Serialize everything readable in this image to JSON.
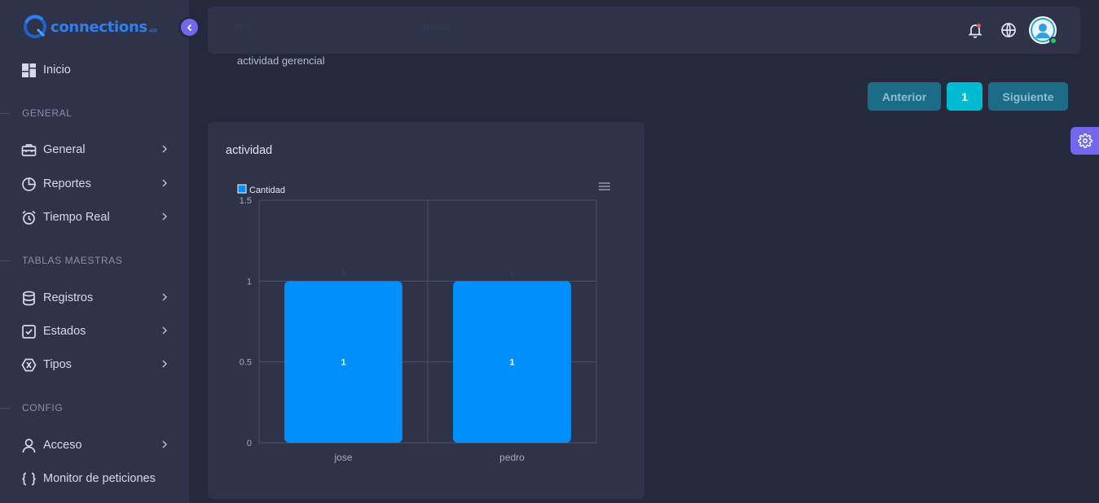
{
  "app": {
    "logo_text": "connections",
    "logo_sub": "app"
  },
  "sidebar": {
    "home": {
      "label": "Inicio",
      "icon": "dashboard-icon"
    },
    "sections": [
      {
        "title": "GENERAL"
      },
      {
        "title": "TABLAS MAESTRAS"
      },
      {
        "title": "CONFIG"
      }
    ],
    "items": [
      {
        "label": "General",
        "icon": "briefcase-icon"
      },
      {
        "label": "Reportes",
        "icon": "pie-chart-icon"
      },
      {
        "label": "Tiempo Real",
        "icon": "alarm-clock-icon"
      },
      {
        "label": "Registros",
        "icon": "database-icon"
      },
      {
        "label": "Estados",
        "icon": "checkbox-icon"
      },
      {
        "label": "Tipos",
        "icon": "hexagon-icon"
      },
      {
        "label": "Acceso",
        "icon": "user-icon"
      },
      {
        "label": "Monitor de peticiones",
        "icon": "braces-icon"
      }
    ]
  },
  "navbar": {
    "faded_text_1": "Inici",
    "faded_text_2": "Busca",
    "icons": [
      "bell-icon",
      "globe-icon",
      "avatar"
    ]
  },
  "breadcrumb": "actividad gerencial",
  "pagination": {
    "prev": "Anterior",
    "current": "1",
    "next": "Siguiente"
  },
  "card": {
    "title": "actividad"
  },
  "colors": {
    "accent": "#7367f0",
    "bar": "#008ffb",
    "pager": "#00bad1",
    "online": "#28c76f"
  },
  "chart_data": {
    "type": "bar",
    "title": "actividad",
    "categories": [
      "jose",
      "pedro"
    ],
    "series": [
      {
        "name": "Cantidad",
        "values": [
          1,
          1
        ]
      }
    ],
    "ylim": [
      0,
      1.5
    ],
    "yticks": [
      0,
      0.5,
      1,
      1.5
    ],
    "ytick_labels": [
      "0",
      "0.5",
      "1",
      "1.5"
    ],
    "data_labels": true,
    "grid": true,
    "legend": "top-left"
  }
}
